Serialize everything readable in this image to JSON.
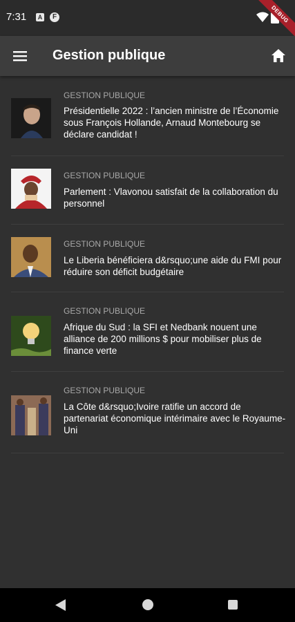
{
  "status_bar": {
    "time": "7:31",
    "icon_a": "A",
    "icon_f": "F",
    "debug_label": "DEBUG"
  },
  "app_bar": {
    "title": "Gestion publique",
    "menu_icon": "hamburger-menu-icon",
    "home_icon": "home-icon"
  },
  "articles": [
    {
      "category": "GESTION PUBLIQUE",
      "title": "Présidentielle 2022 : l’ancien ministre de l’Économie sous François Hollande, Arnaud Montebourg se déclare candidat !",
      "thumb_colors": [
        "#1a1a1a",
        "#c9a48a",
        "#2a3b5c"
      ]
    },
    {
      "category": "GESTION PUBLIQUE",
      "title": "Parlement : Vlavonou satisfait de la collaboration du personnel",
      "thumb_colors": [
        "#f4f4f4",
        "#b7262b",
        "#e8c9a0"
      ]
    },
    {
      "category": "GESTION PUBLIQUE",
      "title": "Le Liberia bénéficiera d&rsquo;une aide du FMI pour réduire son déficit budgétaire",
      "thumb_colors": [
        "#b98e4e",
        "#5b3a22",
        "#3a4d7a"
      ]
    },
    {
      "category": "GESTION PUBLIQUE",
      "title": "Afrique du Sud : la SFI et Nedbank nouent une alliance de 200 millions $ pour mobiliser plus de finance verte",
      "thumb_colors": [
        "#2e4a1c",
        "#f3d27a",
        "#6b8e3a"
      ]
    },
    {
      "category": "GESTION PUBLIQUE",
      "title": "La Côte d&rsquo;Ivoire ratifie un accord de partenariat économique intérimaire avec le Royaume-Uni",
      "thumb_colors": [
        "#8c6a55",
        "#3b3b5c",
        "#c9b08a"
      ]
    }
  ],
  "nav_bar": {
    "back_icon": "back-triangle-icon",
    "home_icon": "home-circle-icon",
    "recents_icon": "recents-square-icon"
  }
}
